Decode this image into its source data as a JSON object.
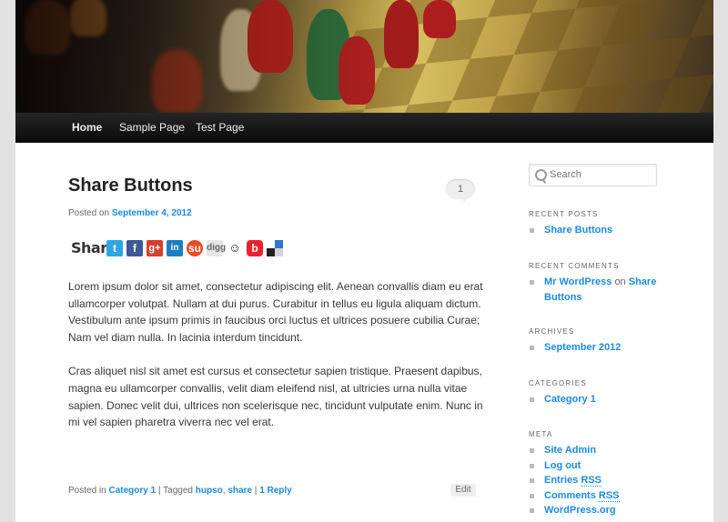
{
  "nav": {
    "items": [
      {
        "label": "Home",
        "current": true
      },
      {
        "label": "Sample Page",
        "current": false
      },
      {
        "label": "Test Page",
        "current": false
      }
    ]
  },
  "post": {
    "title": "Share Buttons",
    "comment_count": "1",
    "posted_on_label": "Posted on",
    "date": "September 4, 2012",
    "share_label": "Share",
    "share_icons": [
      "twitter-icon",
      "facebook-icon",
      "google-plus-icon",
      "linkedin-icon",
      "stumbleupon-icon",
      "digg-icon",
      "reddit-icon",
      "blogger-icon",
      "delicious-icon"
    ],
    "paragraphs": [
      "Lorem ipsum dolor sit amet, consectetur adipiscing elit. Aenean convallis diam eu erat ullamcorper volutpat. Nullam at dui purus. Curabitur in tellus eu ligula aliquam dictum. Vestibulum ante ipsum primis in faucibus orci luctus et ultrices posuere cubilia Curae; Nam vel diam nulla. In lacinia interdum tincidunt.",
      "Cras aliquet nisl sit amet est cursus et consectetur sapien tristique. Praesent dapibus, magna eu ullamcorper convallis, velit diam eleifend nisl, at ultricies urna nulla vitae sapien. Donec velit dui, ultrices non scelerisque nec, tincidunt vulputate enim. Nunc in mi vel sapien pharetra viverra nec vel erat."
    ],
    "footer": {
      "posted_in_label": "Posted in",
      "category": "Category 1",
      "tagged_label": "Tagged",
      "tag1": "hupso",
      "tag2": "share",
      "reply": "1 Reply",
      "sep": "|",
      "comma": ","
    },
    "edit_label": "Edit"
  },
  "sidebar": {
    "search_placeholder": "Search",
    "recent_posts_title": "Recent Posts",
    "recent_posts": [
      "Share Buttons"
    ],
    "recent_comments_title": "Recent Comments",
    "recent_comment": {
      "author": "Mr WordPress",
      "on": "on",
      "post": "Share Buttons"
    },
    "archives_title": "Archives",
    "archives": [
      "September 2012"
    ],
    "categories_title": "Categories",
    "categories": [
      "Category 1"
    ],
    "meta_title": "Meta",
    "meta": {
      "site_admin": "Site Admin",
      "log_out": "Log out",
      "entries": "Entries",
      "comments": "Comments",
      "rss": "RSS",
      "wordpress": "WordPress.org"
    }
  },
  "colors": {
    "link": "#1b8be0",
    "nav_bg": "#0a0a0a",
    "page_bg": "#e2e2e2"
  }
}
